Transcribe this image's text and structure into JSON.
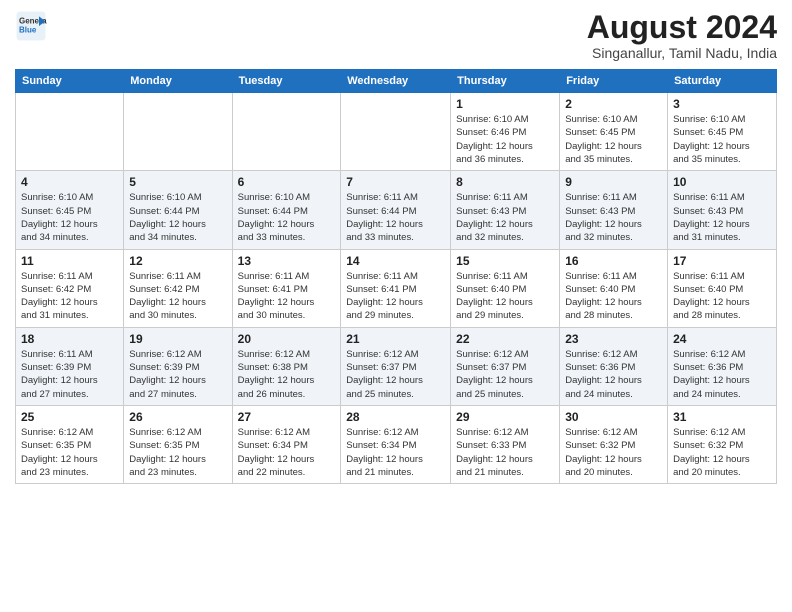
{
  "logo": {
    "line1": "General",
    "line2": "Blue"
  },
  "title": "August 2024",
  "subtitle": "Singanallur, Tamil Nadu, India",
  "weekdays": [
    "Sunday",
    "Monday",
    "Tuesday",
    "Wednesday",
    "Thursday",
    "Friday",
    "Saturday"
  ],
  "weeks": [
    [
      {
        "day": "",
        "info": ""
      },
      {
        "day": "",
        "info": ""
      },
      {
        "day": "",
        "info": ""
      },
      {
        "day": "",
        "info": ""
      },
      {
        "day": "1",
        "info": "Sunrise: 6:10 AM\nSunset: 6:46 PM\nDaylight: 12 hours\nand 36 minutes."
      },
      {
        "day": "2",
        "info": "Sunrise: 6:10 AM\nSunset: 6:45 PM\nDaylight: 12 hours\nand 35 minutes."
      },
      {
        "day": "3",
        "info": "Sunrise: 6:10 AM\nSunset: 6:45 PM\nDaylight: 12 hours\nand 35 minutes."
      }
    ],
    [
      {
        "day": "4",
        "info": "Sunrise: 6:10 AM\nSunset: 6:45 PM\nDaylight: 12 hours\nand 34 minutes."
      },
      {
        "day": "5",
        "info": "Sunrise: 6:10 AM\nSunset: 6:44 PM\nDaylight: 12 hours\nand 34 minutes."
      },
      {
        "day": "6",
        "info": "Sunrise: 6:10 AM\nSunset: 6:44 PM\nDaylight: 12 hours\nand 33 minutes."
      },
      {
        "day": "7",
        "info": "Sunrise: 6:11 AM\nSunset: 6:44 PM\nDaylight: 12 hours\nand 33 minutes."
      },
      {
        "day": "8",
        "info": "Sunrise: 6:11 AM\nSunset: 6:43 PM\nDaylight: 12 hours\nand 32 minutes."
      },
      {
        "day": "9",
        "info": "Sunrise: 6:11 AM\nSunset: 6:43 PM\nDaylight: 12 hours\nand 32 minutes."
      },
      {
        "day": "10",
        "info": "Sunrise: 6:11 AM\nSunset: 6:43 PM\nDaylight: 12 hours\nand 31 minutes."
      }
    ],
    [
      {
        "day": "11",
        "info": "Sunrise: 6:11 AM\nSunset: 6:42 PM\nDaylight: 12 hours\nand 31 minutes."
      },
      {
        "day": "12",
        "info": "Sunrise: 6:11 AM\nSunset: 6:42 PM\nDaylight: 12 hours\nand 30 minutes."
      },
      {
        "day": "13",
        "info": "Sunrise: 6:11 AM\nSunset: 6:41 PM\nDaylight: 12 hours\nand 30 minutes."
      },
      {
        "day": "14",
        "info": "Sunrise: 6:11 AM\nSunset: 6:41 PM\nDaylight: 12 hours\nand 29 minutes."
      },
      {
        "day": "15",
        "info": "Sunrise: 6:11 AM\nSunset: 6:40 PM\nDaylight: 12 hours\nand 29 minutes."
      },
      {
        "day": "16",
        "info": "Sunrise: 6:11 AM\nSunset: 6:40 PM\nDaylight: 12 hours\nand 28 minutes."
      },
      {
        "day": "17",
        "info": "Sunrise: 6:11 AM\nSunset: 6:40 PM\nDaylight: 12 hours\nand 28 minutes."
      }
    ],
    [
      {
        "day": "18",
        "info": "Sunrise: 6:11 AM\nSunset: 6:39 PM\nDaylight: 12 hours\nand 27 minutes."
      },
      {
        "day": "19",
        "info": "Sunrise: 6:12 AM\nSunset: 6:39 PM\nDaylight: 12 hours\nand 27 minutes."
      },
      {
        "day": "20",
        "info": "Sunrise: 6:12 AM\nSunset: 6:38 PM\nDaylight: 12 hours\nand 26 minutes."
      },
      {
        "day": "21",
        "info": "Sunrise: 6:12 AM\nSunset: 6:37 PM\nDaylight: 12 hours\nand 25 minutes."
      },
      {
        "day": "22",
        "info": "Sunrise: 6:12 AM\nSunset: 6:37 PM\nDaylight: 12 hours\nand 25 minutes."
      },
      {
        "day": "23",
        "info": "Sunrise: 6:12 AM\nSunset: 6:36 PM\nDaylight: 12 hours\nand 24 minutes."
      },
      {
        "day": "24",
        "info": "Sunrise: 6:12 AM\nSunset: 6:36 PM\nDaylight: 12 hours\nand 24 minutes."
      }
    ],
    [
      {
        "day": "25",
        "info": "Sunrise: 6:12 AM\nSunset: 6:35 PM\nDaylight: 12 hours\nand 23 minutes."
      },
      {
        "day": "26",
        "info": "Sunrise: 6:12 AM\nSunset: 6:35 PM\nDaylight: 12 hours\nand 23 minutes."
      },
      {
        "day": "27",
        "info": "Sunrise: 6:12 AM\nSunset: 6:34 PM\nDaylight: 12 hours\nand 22 minutes."
      },
      {
        "day": "28",
        "info": "Sunrise: 6:12 AM\nSunset: 6:34 PM\nDaylight: 12 hours\nand 21 minutes."
      },
      {
        "day": "29",
        "info": "Sunrise: 6:12 AM\nSunset: 6:33 PM\nDaylight: 12 hours\nand 21 minutes."
      },
      {
        "day": "30",
        "info": "Sunrise: 6:12 AM\nSunset: 6:32 PM\nDaylight: 12 hours\nand 20 minutes."
      },
      {
        "day": "31",
        "info": "Sunrise: 6:12 AM\nSunset: 6:32 PM\nDaylight: 12 hours\nand 20 minutes."
      }
    ]
  ]
}
